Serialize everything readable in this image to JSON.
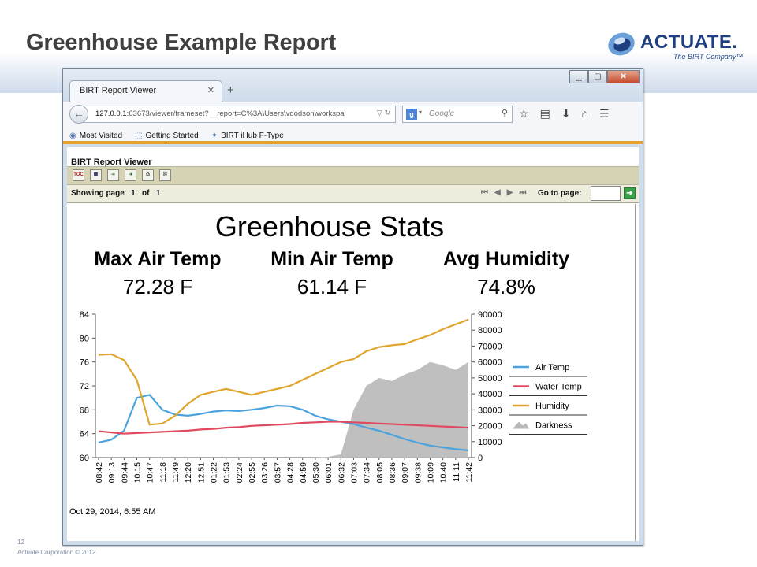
{
  "slide": {
    "title": "Greenhouse Example Report",
    "logo_text": "ACTUATE.",
    "logo_sub": "The BIRT Company™",
    "slide_number": "12",
    "copyright": "Actuate Corporation © 2012"
  },
  "browser": {
    "tab_title": "BIRT Report Viewer",
    "url_host": "127.0.0.1",
    "url_rest": ":63673/viewer/frameset?__report=C%3A\\Users\\vdodson\\workspa",
    "search_placeholder": "Google",
    "bookmarks": [
      "Most Visited",
      "Getting Started",
      "BIRT iHub F-Type"
    ]
  },
  "viewer": {
    "title": "BIRT Report Viewer",
    "showing_label": "Showing page",
    "page_current": "1",
    "of_label": "of",
    "page_total": "1",
    "goto_label": "Go to page:"
  },
  "report": {
    "title": "Greenhouse Stats",
    "stats": [
      {
        "label": "Max Air Temp",
        "value": "72.28 F"
      },
      {
        "label": "Min Air Temp",
        "value": "61.14 F"
      },
      {
        "label": "Avg Humidity",
        "value": "74.8%"
      }
    ],
    "timestamp": "Oct 29, 2014, 6:55 AM"
  },
  "chart_data": {
    "type": "line",
    "x": [
      "08:42",
      "09:13",
      "09:44",
      "10:15",
      "10:47",
      "11:18",
      "11:49",
      "12:20",
      "12:51",
      "01:22",
      "01:53",
      "02:24",
      "02:55",
      "03:26",
      "03:57",
      "04:28",
      "04:59",
      "05:30",
      "06:01",
      "06:32",
      "07:03",
      "07:34",
      "08:05",
      "08:36",
      "09:07",
      "09:38",
      "10:09",
      "10:40",
      "11:11",
      "11:42"
    ],
    "ylim_left": [
      60,
      84
    ],
    "yticks_left": [
      60,
      64,
      68,
      72,
      76,
      80,
      84
    ],
    "ylim_right": [
      0,
      90000
    ],
    "yticks_right": [
      0,
      10000,
      20000,
      30000,
      40000,
      50000,
      60000,
      70000,
      80000,
      90000
    ],
    "series": [
      {
        "name": "Air Temp",
        "color": "#4aa3dc",
        "axis": "left",
        "values": [
          62.5,
          63.0,
          64.5,
          70.0,
          70.5,
          68.0,
          67.2,
          67.0,
          67.3,
          67.7,
          67.9,
          67.8,
          68.0,
          68.3,
          68.7,
          68.6,
          68.0,
          67.0,
          66.4,
          66.0,
          65.6,
          65.0,
          64.5,
          63.8,
          63.1,
          62.5,
          62.0,
          61.7,
          61.4,
          61.2
        ]
      },
      {
        "name": "Water Temp",
        "color": "#e04a60",
        "axis": "left",
        "values": [
          64.4,
          64.2,
          64.0,
          64.1,
          64.2,
          64.3,
          64.4,
          64.5,
          64.7,
          64.8,
          65.0,
          65.1,
          65.3,
          65.4,
          65.5,
          65.6,
          65.8,
          65.9,
          66.0,
          66.0,
          65.9,
          65.8,
          65.7,
          65.6,
          65.5,
          65.4,
          65.3,
          65.2,
          65.1,
          65.0
        ]
      },
      {
        "name": "Humidity",
        "color": "#e0a52c",
        "axis": "left",
        "values": [
          77.2,
          77.3,
          76.3,
          73.0,
          65.5,
          65.7,
          67.0,
          69.0,
          70.5,
          71.0,
          71.5,
          71.0,
          70.5,
          71.0,
          71.5,
          72.0,
          73.0,
          74.0,
          75.0,
          76.0,
          76.5,
          77.8,
          78.5,
          78.8,
          79.0,
          79.8,
          80.5,
          81.5,
          82.3,
          83.1
        ]
      },
      {
        "name": "Darkness",
        "color": "#b8b8b8",
        "axis": "right",
        "values": [
          0,
          0,
          0,
          0,
          0,
          0,
          0,
          0,
          0,
          0,
          0,
          0,
          0,
          0,
          0,
          0,
          0,
          0,
          500,
          2000,
          30000,
          45000,
          50000,
          48000,
          52000,
          55000,
          60000,
          58000,
          55000,
          60000
        ]
      }
    ],
    "legend_position": "right"
  }
}
